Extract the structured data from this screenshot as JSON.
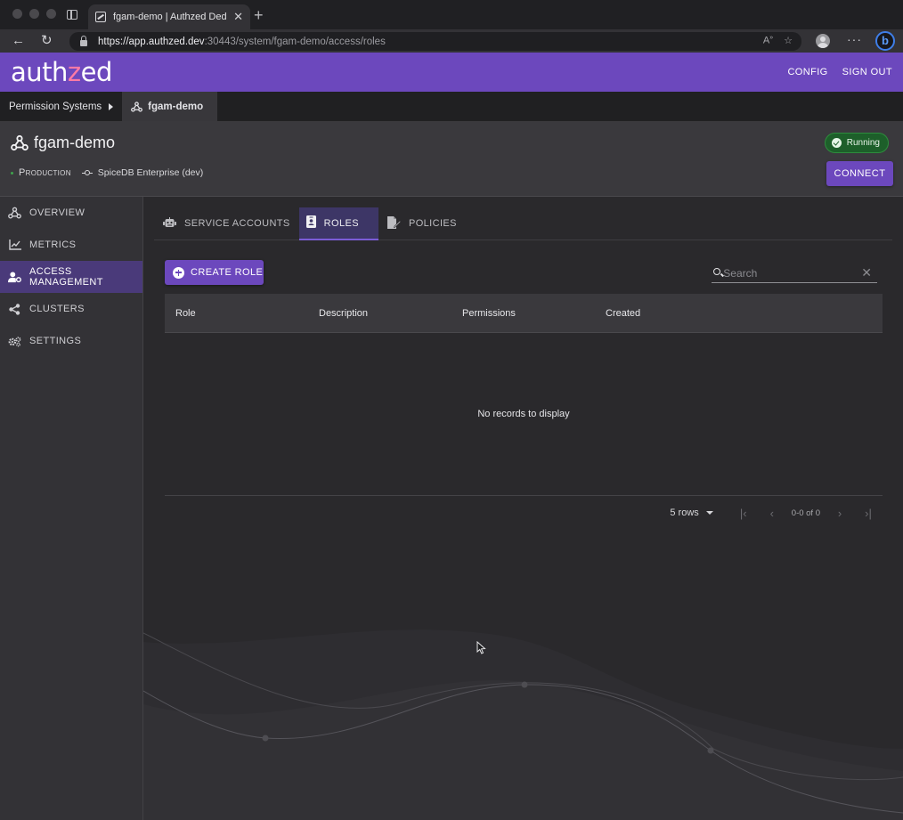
{
  "browser": {
    "tab_title": "fgam-demo | Authzed Dedicate",
    "url_host": "https://app.authzed.dev",
    "url_path": ":30443/system/fgam-demo/access/roles"
  },
  "app": {
    "logo_prefix": "auth",
    "logo_z": "z",
    "logo_suffix": "ed",
    "config_label": "CONFIG",
    "signout_label": "SIGN OUT"
  },
  "breadcrumb": {
    "root": "Permission Systems",
    "current": "fgam-demo"
  },
  "system": {
    "name": "fgam-demo",
    "environment": "Production",
    "edition": "SpiceDB Enterprise (dev)",
    "status": "Running",
    "status_color": "#1d5f2a",
    "connect_label": "CONNECT"
  },
  "sidebar": {
    "items": [
      {
        "label": "OVERVIEW",
        "icon": "webhook-icon"
      },
      {
        "label": "METRICS",
        "icon": "chart-line-icon"
      },
      {
        "label": "ACCESS MANAGEMENT",
        "icon": "user-cog-icon",
        "active": true
      },
      {
        "label": "CLUSTERS",
        "icon": "share-nodes-icon"
      },
      {
        "label": "SETTINGS",
        "icon": "gears-icon"
      }
    ]
  },
  "tabs": [
    {
      "label": "SERVICE ACCOUNTS",
      "icon": "robot-icon"
    },
    {
      "label": "ROLES",
      "icon": "id-badge-icon",
      "active": true
    },
    {
      "label": "POLICIES",
      "icon": "file-signature-icon"
    }
  ],
  "roles": {
    "create_label": "CREATE ROLE",
    "search_placeholder": "Search",
    "columns": [
      "Role",
      "Description",
      "Permissions",
      "Created"
    ],
    "empty_message": "No records to display",
    "rows_per_page": "5 rows",
    "page_info": "0-0 of 0"
  },
  "colors": {
    "accent": "#6c48bd",
    "header_bg": "#6c48bd",
    "active_nav": "#4a3a7a"
  }
}
